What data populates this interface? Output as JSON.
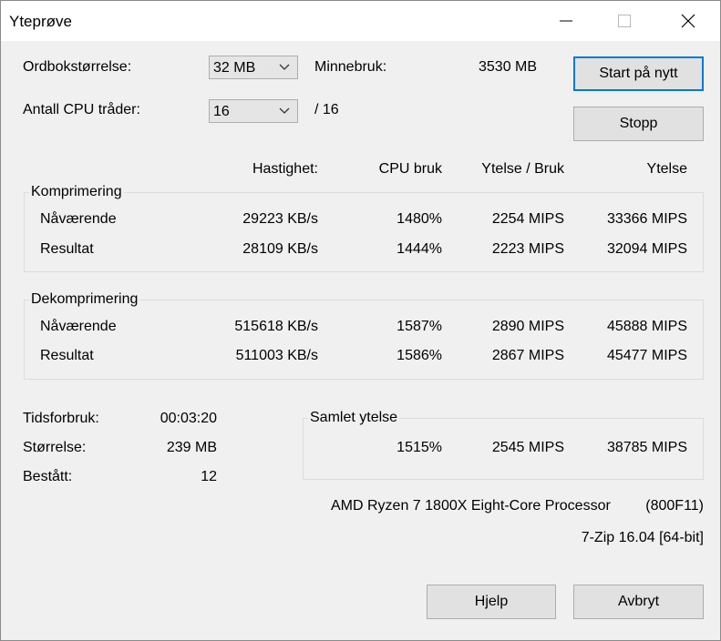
{
  "window": {
    "title": "Yteprøve",
    "minimize_icon": "minimize-icon",
    "maximize_icon": "maximize-icon",
    "close_icon": "close-icon"
  },
  "settings": {
    "dictionary_label": "Ordbokstørrelse:",
    "dictionary_value": "32 MB",
    "memory_label": "Minnebruk:",
    "memory_value": "3530 MB",
    "threads_label": "Antall CPU tråder:",
    "threads_value": "16",
    "threads_total": "/ 16"
  },
  "buttons": {
    "restart": "Start på nytt",
    "stop": "Stopp",
    "help": "Hjelp",
    "cancel": "Avbryt"
  },
  "columns": {
    "speed": "Hastighet:",
    "cpu": "CPU bruk",
    "perf_usage": "Ytelse / Bruk",
    "perf": "Ytelse"
  },
  "compression": {
    "title": "Komprimering",
    "rows": [
      {
        "label": "Nåværende",
        "speed": "29223 KB/s",
        "cpu": "1480%",
        "perf_usage": "2254 MIPS",
        "perf": "33366 MIPS"
      },
      {
        "label": "Resultat",
        "speed": "28109 KB/s",
        "cpu": "1444%",
        "perf_usage": "2223 MIPS",
        "perf": "32094 MIPS"
      }
    ]
  },
  "decompression": {
    "title": "Dekomprimering",
    "rows": [
      {
        "label": "Nåværende",
        "speed": "515618 KB/s",
        "cpu": "1587%",
        "perf_usage": "2890 MIPS",
        "perf": "45888 MIPS"
      },
      {
        "label": "Resultat",
        "speed": "511003 KB/s",
        "cpu": "1586%",
        "perf_usage": "2867 MIPS",
        "perf": "45477 MIPS"
      }
    ]
  },
  "stats": {
    "time_label": "Tidsforbruk:",
    "time_value": "00:03:20",
    "size_label": "Størrelse:",
    "size_value": "239 MB",
    "passed_label": "Bestått:",
    "passed_value": "12"
  },
  "total": {
    "title": "Samlet ytelse",
    "cpu": "1515%",
    "perf_usage": "2545 MIPS",
    "perf": "38785 MIPS"
  },
  "system": {
    "cpu_name": "AMD Ryzen 7 1800X Eight-Core Processor",
    "cpu_id": "(800F11)",
    "version": "7-Zip 16.04 [64-bit]"
  },
  "colors": {
    "accent": "#0078d7",
    "dialog_bg": "#f0f0f0",
    "button_bg": "#e1e1e1"
  }
}
